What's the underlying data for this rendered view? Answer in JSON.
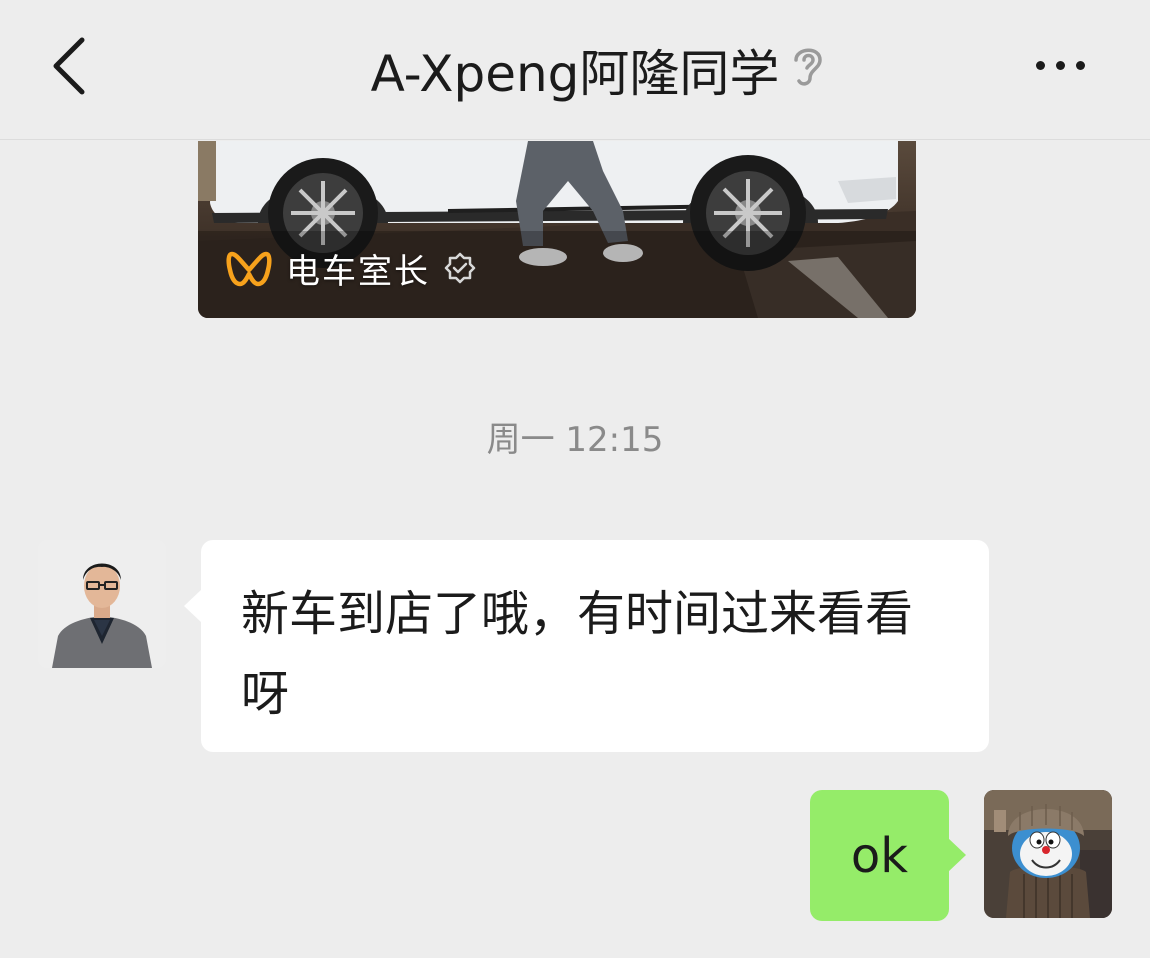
{
  "header": {
    "title": "A-Xpeng阿隆同学",
    "back_icon": "chevron-left-icon",
    "mode_icon": "ear-icon",
    "more_icon": "more-dots-icon"
  },
  "video_card": {
    "channel_name": "电车室长",
    "channel_icon": "channels-logo-icon",
    "verified_icon": "verified-badge-icon"
  },
  "timestamp": "周一 12:15",
  "messages": [
    {
      "direction": "incoming",
      "text": "新车到店了哦，有时间过来看看呀"
    },
    {
      "direction": "outgoing",
      "text": "ok"
    }
  ],
  "colors": {
    "background": "#ededed",
    "incoming_bubble": "#ffffff",
    "outgoing_bubble": "#95ec69",
    "timestamp_text": "#8a8a8a",
    "channel_logo": "#f7a21c"
  }
}
